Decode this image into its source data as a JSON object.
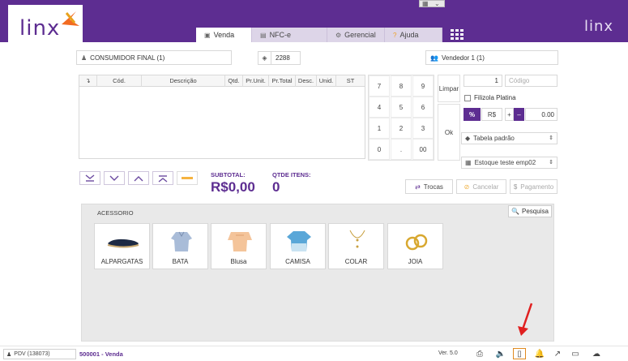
{
  "header": {
    "logo_text": "linx",
    "logo_right_text": "linx",
    "tabs": [
      {
        "label": "Venda",
        "icon": "cart-icon"
      },
      {
        "label": "NFC-e",
        "icon": "document-icon"
      },
      {
        "label": "Gerencial",
        "icon": "gears-icon"
      },
      {
        "label": "Ajuda",
        "icon": "question-icon"
      }
    ]
  },
  "customer": {
    "name": "CONSUMIDOR FINAL (1)"
  },
  "ticket": {
    "number": "2288"
  },
  "seller": {
    "name": "Vendedor 1 (1)"
  },
  "table": {
    "columns": [
      "↴",
      "Cód.",
      "Descrição",
      "Qtd.",
      "Pr.Unit.",
      "Pr.Total",
      "Desc.",
      "Unid.",
      "ST"
    ]
  },
  "numpad": {
    "keys": [
      "7",
      "8",
      "9",
      "4",
      "5",
      "6",
      "1",
      "2",
      "3",
      "0",
      ".",
      "00"
    ],
    "clear_label": "Limpar",
    "ok_label": "Ok"
  },
  "right_panel": {
    "quantity": "1",
    "code_placeholder": "Código",
    "filizola_label": "Filizola Platina",
    "percent_label": "%",
    "currency_label": "R$",
    "plus_label": "+",
    "minus_label": "–",
    "discount_value": "0.00",
    "price_table": "Tabela padrão",
    "stock": "Estoque teste emp02"
  },
  "totals": {
    "subtotal_label": "SUBTOTAL:",
    "subtotal_value": "R$0,00",
    "qty_label": "QTDE ITENS:",
    "qty_value": "0"
  },
  "actions": {
    "trocas": "Trocas",
    "cancelar": "Cancelar",
    "pagamento": "Pagamento"
  },
  "products": {
    "category": "ACESSORIO",
    "search_label": "Pesquisa",
    "items": [
      {
        "name": "ALPARGATAS"
      },
      {
        "name": "BATA"
      },
      {
        "name": "Blusa"
      },
      {
        "name": "CAMISA"
      },
      {
        "name": "COLAR"
      },
      {
        "name": "JOIA"
      }
    ]
  },
  "status": {
    "pdv": "PDV (138073)",
    "venda": "500001 - Venda",
    "version": "Ver. 5.0"
  },
  "colors": {
    "brand": "#5d2d91",
    "accent": "#f5b340",
    "arrow": "#e02020"
  }
}
